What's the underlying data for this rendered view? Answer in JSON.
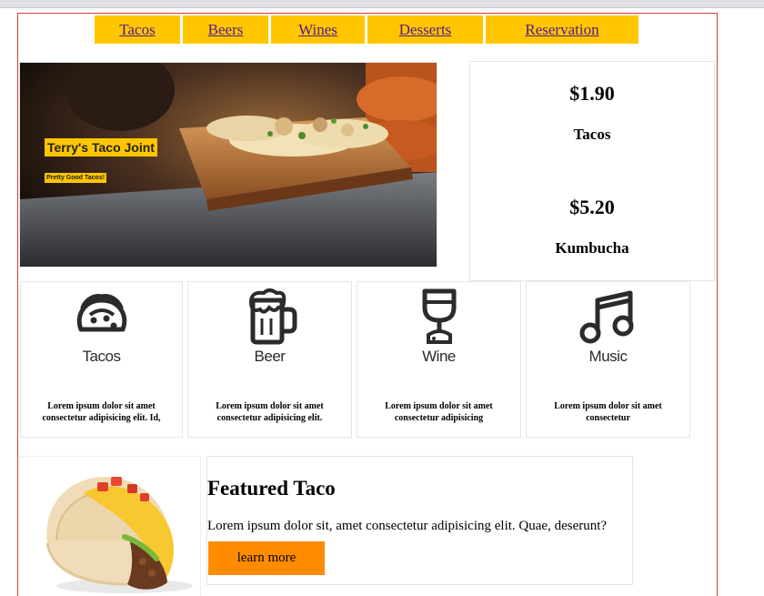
{
  "nav": {
    "items": [
      {
        "label": "Tacos"
      },
      {
        "label": "Beers"
      },
      {
        "label": "Wines"
      },
      {
        "label": "Desserts"
      },
      {
        "label": "Reservation"
      }
    ]
  },
  "hero": {
    "title": "Terry's Taco Joint",
    "subtitle": "Pretty Good Tacos!"
  },
  "prices": [
    {
      "price": "$1.90",
      "label": "Tacos"
    },
    {
      "price": "$5.20",
      "label": "Kumbucha"
    }
  ],
  "features": [
    {
      "icon": "taco-icon",
      "title": "Tacos",
      "text": "Lorem ipsum dolor sit amet consectetur adipisicing elit. Id,"
    },
    {
      "icon": "beer-mug-icon",
      "title": "Beer",
      "text": "Lorem ipsum dolor sit amet consectetur adipisicing elit."
    },
    {
      "icon": "wine-glass-icon",
      "title": "Wine",
      "text": "Lorem ipsum dolor sit amet consectetur adipisicing"
    },
    {
      "icon": "music-note-icon",
      "title": "Music",
      "text": "Lorem ipsum dolor sit amet consectetur"
    }
  ],
  "featured": {
    "title": "Featured Taco",
    "text": "Lorem ipsum dolor sit, amet consectetur adipisicing elit. Quae, deserunt?",
    "button_label": "learn more"
  },
  "colors": {
    "nav_background": "#ffc600",
    "button_background": "#ff8c00",
    "link": "#551a8b",
    "frame_border": "#d33b3b"
  }
}
